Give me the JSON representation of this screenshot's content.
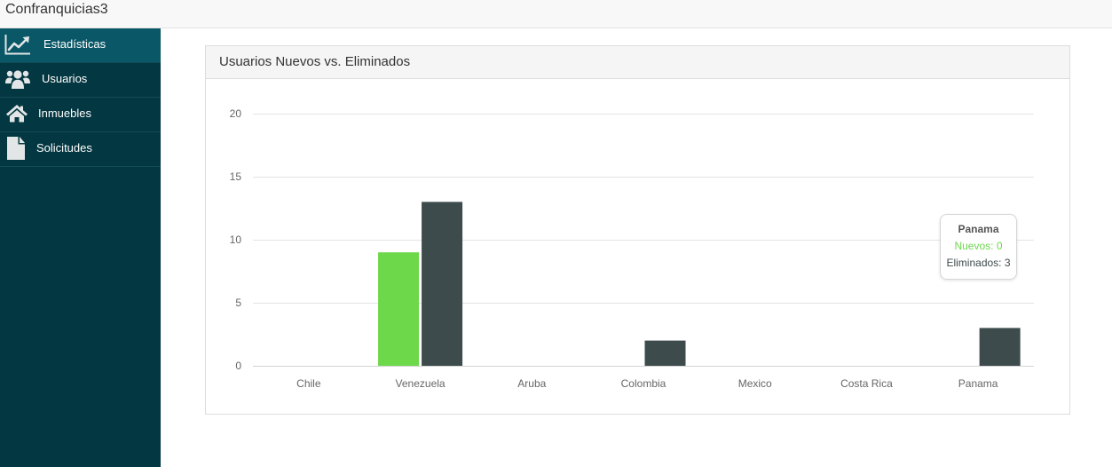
{
  "app": {
    "title": "Confranquicias3"
  },
  "theme": {
    "topbar_bg": "#f8f8f8",
    "sidebar_bg": "#033741",
    "sidebar_active_bg": "#0a5767",
    "panel_header_bg": "#f5f5f5"
  },
  "sidebar": {
    "items": [
      {
        "label": "Estadísticas",
        "icon": "line-chart-icon",
        "active": true
      },
      {
        "label": "Usuarios",
        "icon": "users-icon",
        "active": false
      },
      {
        "label": "Inmuebles",
        "icon": "home-icon",
        "active": false
      },
      {
        "label": "Solicitudes",
        "icon": "file-icon",
        "active": false
      }
    ]
  },
  "chart_data": {
    "type": "bar",
    "title": "Usuarios Nuevos vs. Eliminados",
    "xlabel": "",
    "ylabel": "",
    "categories": [
      "Chile",
      "Venezuela",
      "Aruba",
      "Colombia",
      "Mexico",
      "Costa Rica",
      "Panama"
    ],
    "series": [
      {
        "name": "Nuevos",
        "color": "#6cd84a",
        "values": [
          0,
          9,
          0,
          0,
          0,
          0,
          0
        ]
      },
      {
        "name": "Eliminados",
        "color": "#3e4b4c",
        "values": [
          0,
          13,
          0,
          2,
          0,
          0,
          3
        ]
      }
    ],
    "ylim": [
      0,
      20
    ],
    "yticks": [
      0,
      5,
      10,
      15,
      20
    ],
    "grid": true,
    "legend": "none",
    "tooltip": {
      "category": "Panama"
    }
  }
}
